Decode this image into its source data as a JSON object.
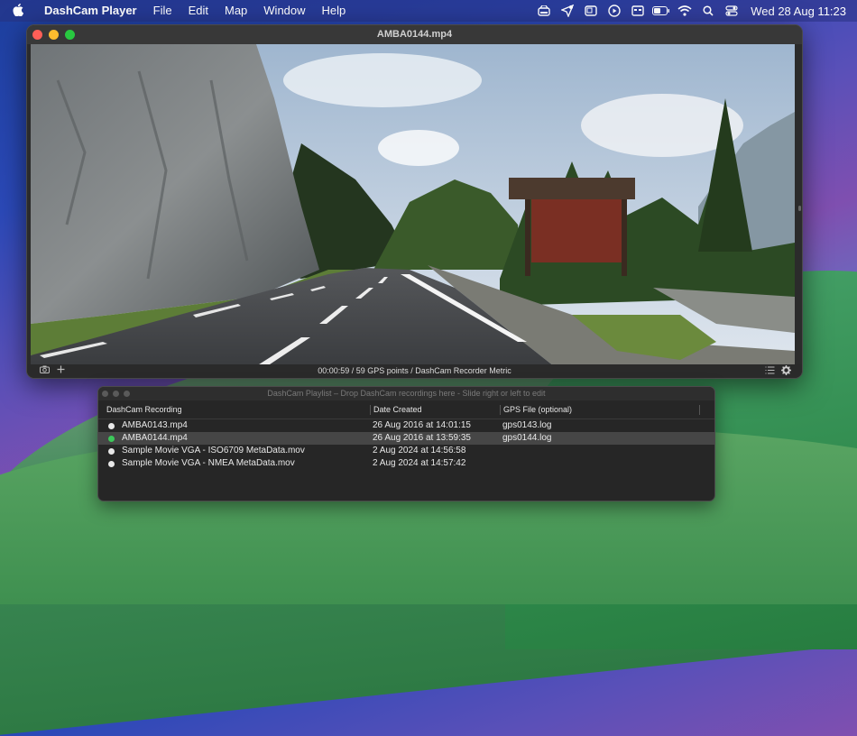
{
  "menubar": {
    "app_name": "DashCam Player",
    "items": [
      "File",
      "Edit",
      "Map",
      "Window",
      "Help"
    ],
    "clock": "Wed 28 Aug  11:23",
    "status_icons": [
      "drive-icon",
      "location-icon",
      "window-icon",
      "play-icon",
      "display-icon",
      "battery-icon",
      "wifi-icon",
      "search-icon",
      "control-center-icon"
    ]
  },
  "main_window": {
    "title": "AMBA0144.mp4",
    "status": "00:00:59 / 59 GPS points / DashCam Recorder Metric"
  },
  "playlist": {
    "title": "DashCam Playlist – Drop DashCam recordings here - Slide right or left to edit",
    "columns": [
      "DashCam Recording",
      "Date Created",
      "GPS File (optional)"
    ],
    "rows": [
      {
        "name": "AMBA0143.mp4",
        "date": "26 Aug 2016 at 14:01:15",
        "gps": "gps0143.log",
        "status": "white"
      },
      {
        "name": "AMBA0144.mp4",
        "date": "26 Aug 2016 at 13:59:35",
        "gps": "gps0144.log",
        "status": "green"
      },
      {
        "name": "Sample Movie VGA - ISO6709 MetaData.mov",
        "date": "2 Aug 2024 at 14:56:58",
        "gps": "",
        "status": "white"
      },
      {
        "name": "Sample Movie VGA - NMEA MetaData.mov",
        "date": "2 Aug 2024 at 14:57:42",
        "gps": "",
        "status": "white"
      }
    ],
    "selected_index": 1
  },
  "colors": {
    "traffic_red": "#fe5f57",
    "traffic_yellow": "#febc2e",
    "traffic_green": "#28c840",
    "active_dot": "#3cc85a"
  }
}
